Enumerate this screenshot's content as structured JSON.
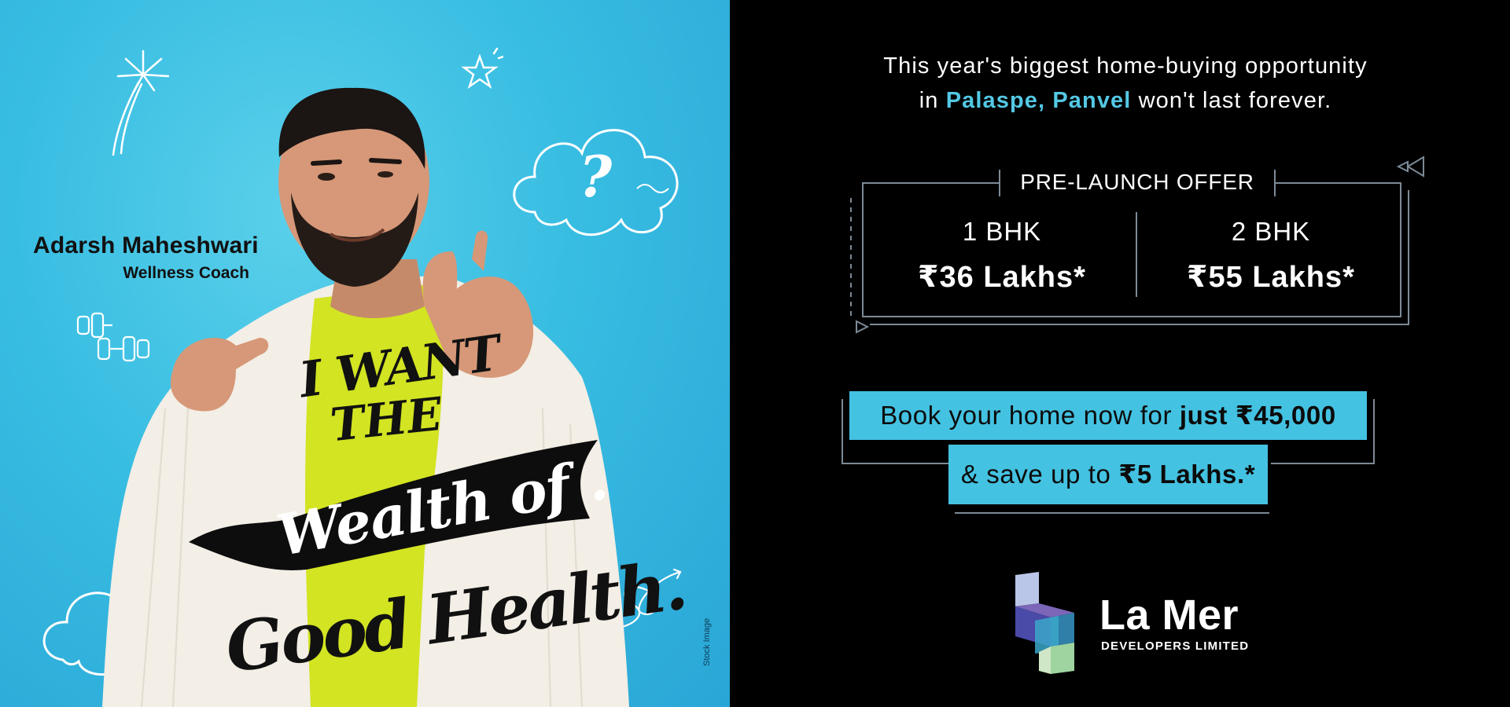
{
  "person": {
    "name": "Adarsh Maheshwari",
    "role": "Wellness Coach"
  },
  "slogan": {
    "line1": "I WANT",
    "line2": "THE",
    "line3": "Wealth of .",
    "line4": "Good Health."
  },
  "stock_note": "Stock Image",
  "headline": {
    "line1": "This year's biggest home-buying opportunity",
    "line2_prefix": "in",
    "location": "Palaspe, Panvel",
    "line2_suffix": "won't last forever."
  },
  "offer": {
    "title": "PRE-LAUNCH OFFER",
    "options": [
      {
        "type": "1 BHK",
        "price": "₹36 Lakhs*"
      },
      {
        "type": "2 BHK",
        "price": "₹55 Lakhs*"
      }
    ]
  },
  "booking": {
    "prefix": "Book your home now for",
    "amount": "just ₹45,000",
    "save_prefix": "& save up to",
    "save_amount": "₹5 Lakhs.*"
  },
  "brand": {
    "name": "La Mer",
    "subtitle": "DEVELOPERS LIMITED"
  },
  "colors": {
    "accent": "#44c2e1",
    "left_bg": "#38bde2",
    "right_bg": "#000000"
  },
  "icons": [
    "firework-icon",
    "star-icon",
    "cloud-question-icon",
    "cloud-exclamation-icon",
    "dumbbell-icon",
    "spiral-arrow-icon",
    "la-mer-logo-icon"
  ]
}
